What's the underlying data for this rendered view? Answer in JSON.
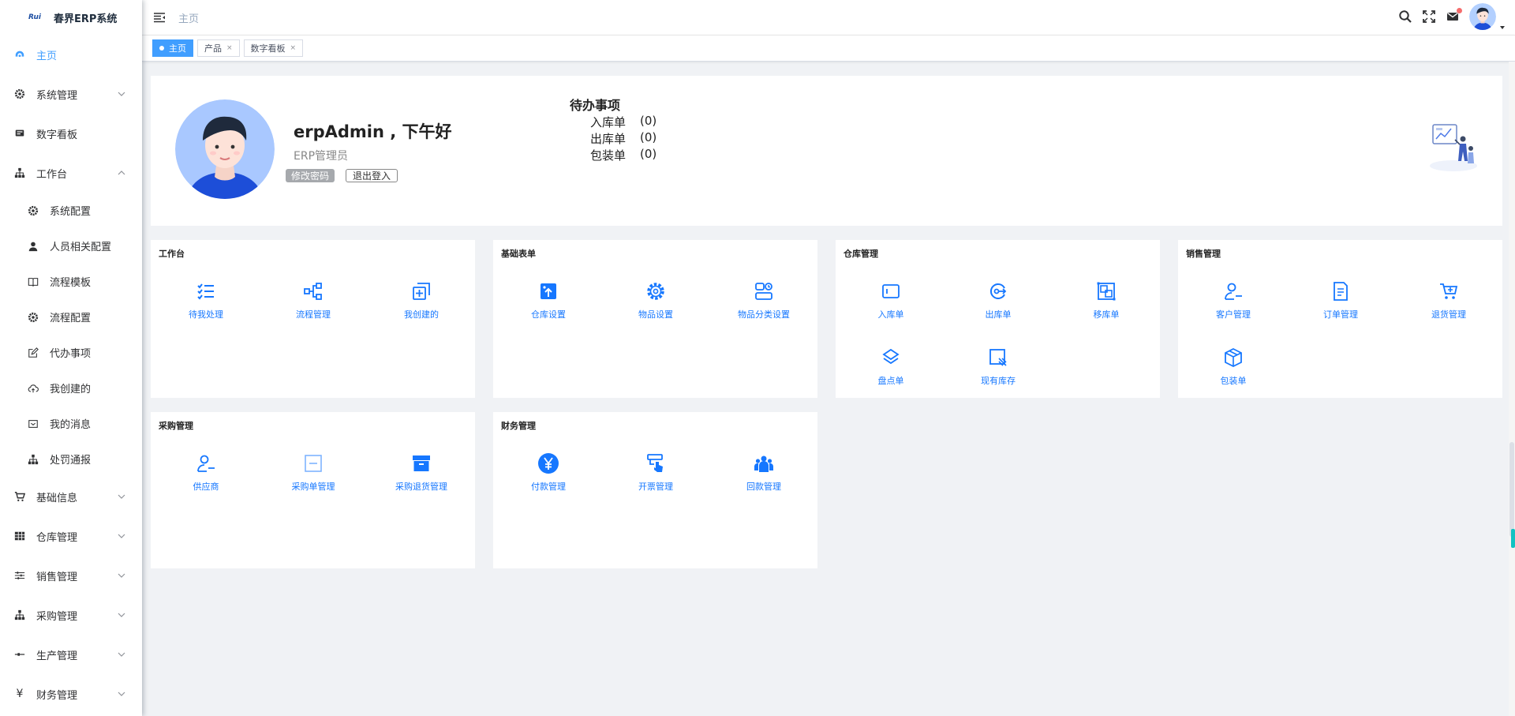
{
  "app": {
    "title": "春界ERP系统",
    "logo_text": "Rui"
  },
  "header": {
    "breadcrumb": "主页"
  },
  "tags": [
    {
      "label": "主页",
      "active": true
    },
    {
      "label": "产品",
      "active": false
    },
    {
      "label": "数字看板",
      "active": false
    }
  ],
  "sidebar": {
    "items": [
      {
        "label": "主页",
        "icon": "dashboard-icon"
      },
      {
        "label": "系统管理",
        "icon": "gear-icon"
      },
      {
        "label": "数字看板",
        "icon": "monitor-icon"
      },
      {
        "label": "工作台",
        "icon": "tree-icon"
      },
      {
        "label": "基础信息",
        "icon": "cart-icon"
      },
      {
        "label": "仓库管理",
        "icon": "table-icon"
      },
      {
        "label": "销售管理",
        "icon": "sliders-icon"
      },
      {
        "label": "采购管理",
        "icon": "tree-icon"
      },
      {
        "label": "生产管理",
        "icon": "line-icon"
      },
      {
        "label": "财务管理",
        "icon": "yen-icon"
      }
    ],
    "workbench_sub": [
      {
        "label": "系统配置",
        "icon": "gear-icon"
      },
      {
        "label": "人员相关配置",
        "icon": "user-icon"
      },
      {
        "label": "流程模板",
        "icon": "book-icon"
      },
      {
        "label": "流程配置",
        "icon": "gear-icon"
      },
      {
        "label": "代办事项",
        "icon": "edit-icon"
      },
      {
        "label": "我创建的",
        "icon": "cloud-icon"
      },
      {
        "label": "我的消息",
        "icon": "mail-icon"
      },
      {
        "label": "处罚通报",
        "icon": "tree-icon"
      }
    ]
  },
  "profile": {
    "greeting": "erpAdmin , 下午好",
    "role": "ERP管理员",
    "change_password": "修改密码",
    "logout": "退出登入",
    "todo_title": "待办事项",
    "todos": [
      {
        "label": "入库单",
        "count": "(0)"
      },
      {
        "label": "出库单",
        "count": "(0)"
      },
      {
        "label": "包装单",
        "count": "(0)"
      }
    ]
  },
  "cards": [
    {
      "title": "工作台",
      "items": [
        {
          "label": "待我处理",
          "icon": "checklist-icon"
        },
        {
          "label": "流程管理",
          "icon": "flow-icon"
        },
        {
          "label": "我创建的",
          "icon": "add-copy-icon"
        }
      ]
    },
    {
      "title": "基础表单",
      "items": [
        {
          "label": "仓库设置",
          "icon": "warehouse-icon"
        },
        {
          "label": "物品设置",
          "icon": "settings-icon"
        },
        {
          "label": "物品分类设置",
          "icon": "category-icon"
        }
      ]
    },
    {
      "title": "仓库管理",
      "items": [
        {
          "label": "入库单",
          "icon": "inbound-icon"
        },
        {
          "label": "出库单",
          "icon": "outbound-icon"
        },
        {
          "label": "移库单",
          "icon": "transfer-icon"
        },
        {
          "label": "盘点单",
          "icon": "layers-icon"
        },
        {
          "label": "现有库存",
          "icon": "stock-icon"
        }
      ]
    },
    {
      "title": "销售管理",
      "items": [
        {
          "label": "客户管理",
          "icon": "customer-icon"
        },
        {
          "label": "订单管理",
          "icon": "document-icon"
        },
        {
          "label": "退货管理",
          "icon": "cart-icon"
        },
        {
          "label": "包装单",
          "icon": "package-icon"
        }
      ]
    },
    {
      "title": "采购管理",
      "items": [
        {
          "label": "供应商",
          "icon": "supplier-icon"
        },
        {
          "label": "采购单管理",
          "icon": "purchase-icon"
        },
        {
          "label": "采购退货管理",
          "icon": "archive-icon"
        }
      ]
    },
    {
      "title": "财务管理",
      "items": [
        {
          "label": "付款管理",
          "icon": "yen-circle-icon"
        },
        {
          "label": "开票管理",
          "icon": "invoice-icon"
        },
        {
          "label": "回款管理",
          "icon": "group-icon"
        }
      ]
    }
  ],
  "colors": {
    "accent": "#409eff",
    "quick_icon": "#1677ff",
    "background": "#f0f2f5"
  }
}
